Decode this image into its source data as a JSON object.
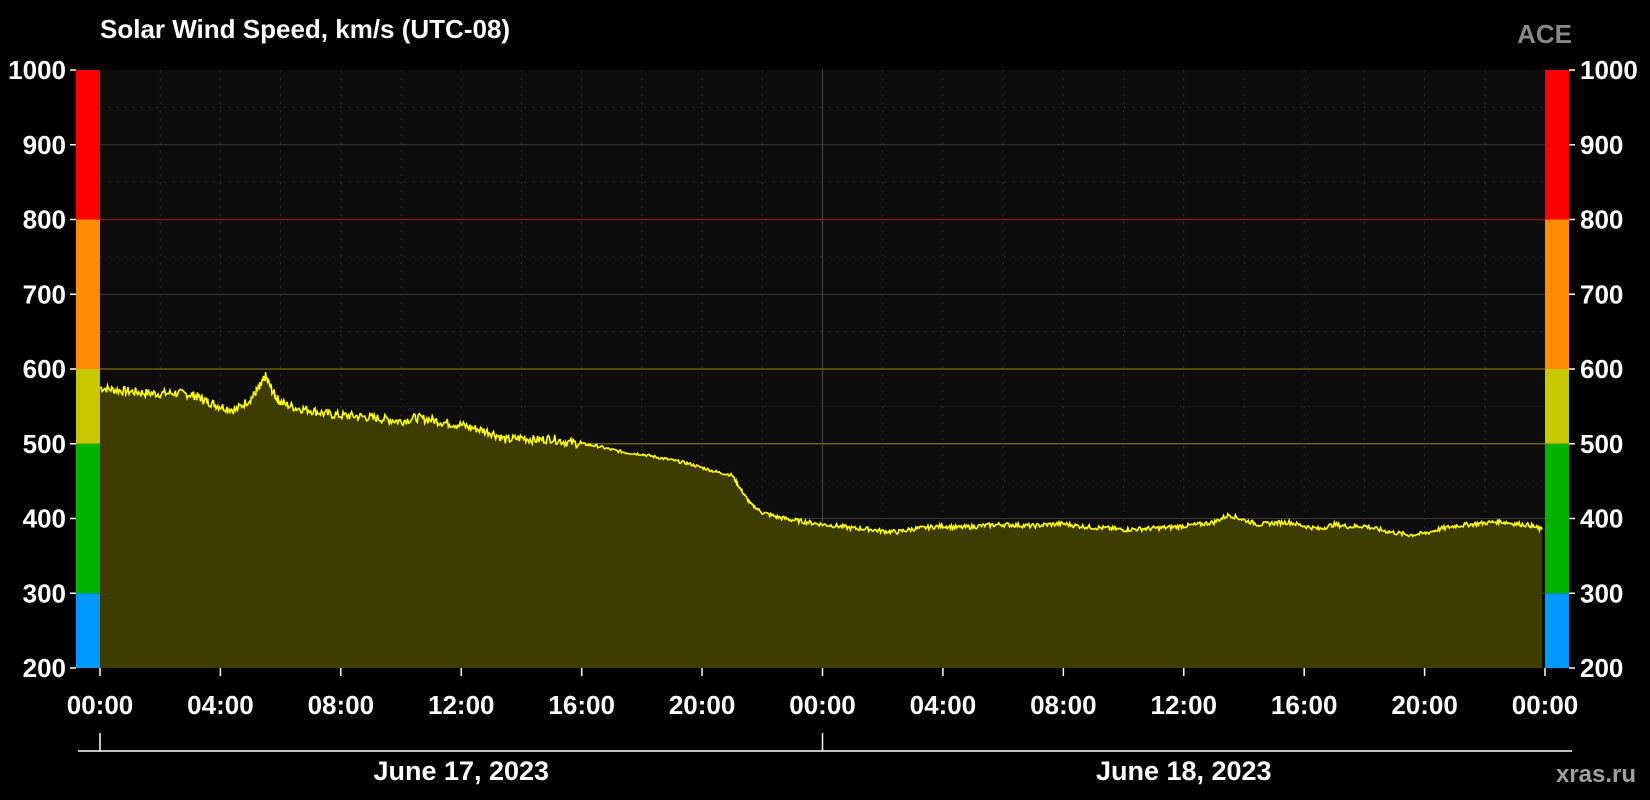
{
  "chart_data": {
    "type": "area",
    "title": "Solar Wind Speed, km/s (UTC-08)",
    "source_label": "ACE",
    "watermark": "xras.ru",
    "ylim": [
      200,
      1000
    ],
    "y_ticks": [
      200,
      300,
      400,
      500,
      600,
      700,
      800,
      900,
      1000
    ],
    "x_range_hours": [
      0,
      48
    ],
    "x_ticks_hours": [
      0,
      4,
      8,
      12,
      16,
      20,
      24,
      28,
      32,
      36,
      40,
      44,
      48
    ],
    "x_tick_labels": [
      "00:00",
      "04:00",
      "08:00",
      "12:00",
      "16:00",
      "20:00",
      "00:00",
      "04:00",
      "08:00",
      "12:00",
      "16:00",
      "20:00",
      "00:00"
    ],
    "date_labels": [
      {
        "text": "June 17, 2023",
        "start_hour": 0,
        "end_hour": 24
      },
      {
        "text": "June 18, 2023",
        "start_hour": 24,
        "end_hour": 48
      }
    ],
    "color_bands": [
      {
        "from": 200,
        "to": 300,
        "color": "#0099ff"
      },
      {
        "from": 300,
        "to": 500,
        "color": "#00b400"
      },
      {
        "from": 500,
        "to": 600,
        "color": "#c8c800"
      },
      {
        "from": 600,
        "to": 800,
        "color": "#ff8c00"
      },
      {
        "from": 800,
        "to": 1000,
        "color": "#ff0000"
      }
    ],
    "threshold_lines": [
      {
        "value": 500,
        "color": "#7a6a00"
      },
      {
        "value": 600,
        "color": "#8a6a00"
      },
      {
        "value": 800,
        "color": "#8a1a00"
      }
    ],
    "colors": {
      "background": "#000000",
      "plot_background": "#0d0d0d",
      "line": "#ffff00",
      "fill": "#3f3c00",
      "grid": "#3a3a3a",
      "text": "#ffffff",
      "source_label": "#888888",
      "watermark": "#a0a0a0"
    },
    "series": [
      {
        "x": [
          0,
          0.5,
          1,
          1.5,
          2,
          2.5,
          3,
          3.3,
          3.6,
          4,
          4.5,
          5,
          5.3,
          5.5,
          5.8,
          6,
          6.5,
          7,
          7.5,
          8,
          8.5,
          9,
          9.5,
          10,
          10.5,
          11,
          11.5,
          12,
          12.5,
          13,
          13.5,
          14,
          14.5,
          15,
          15.5,
          16,
          16.5,
          17,
          17.5,
          18,
          18.5,
          19,
          19.5,
          20,
          20.5,
          21,
          21.3,
          21.6,
          22,
          22.5,
          23,
          23.5,
          24,
          24.5,
          25,
          25.5,
          26,
          26.5,
          27,
          27.5,
          28,
          28.5,
          29,
          29.5,
          30,
          30.5,
          31,
          31.5,
          32,
          32.5,
          33,
          33.5,
          34,
          34.5,
          35,
          35.5,
          36,
          36.5,
          37,
          37.5,
          38,
          38.5,
          39,
          39.5,
          40,
          40.5,
          41,
          41.5,
          42,
          42.5,
          43,
          43.5,
          44,
          44.5,
          45,
          45.5,
          46,
          46.5,
          47,
          47.5,
          47.9
        ],
        "y": [
          575,
          572,
          570,
          568,
          567,
          568,
          566,
          562,
          556,
          550,
          545,
          560,
          575,
          590,
          565,
          555,
          548,
          545,
          540,
          538,
          537,
          535,
          533,
          530,
          535,
          532,
          528,
          525,
          520,
          515,
          505,
          508,
          505,
          507,
          502,
          500,
          497,
          492,
          488,
          486,
          482,
          478,
          474,
          468,
          462,
          458,
          438,
          420,
          408,
          402,
          398,
          395,
          392,
          390,
          387,
          386,
          383,
          382,
          386,
          388,
          390,
          388,
          389,
          391,
          392,
          391,
          390,
          392,
          393,
          390,
          388,
          387,
          385,
          386,
          387,
          388,
          390,
          392,
          395,
          405,
          398,
          392,
          394,
          395,
          390,
          386,
          392,
          389,
          390,
          385,
          381,
          378,
          380,
          386,
          390,
          392,
          394,
          396,
          393,
          391,
          385
        ]
      }
    ]
  }
}
